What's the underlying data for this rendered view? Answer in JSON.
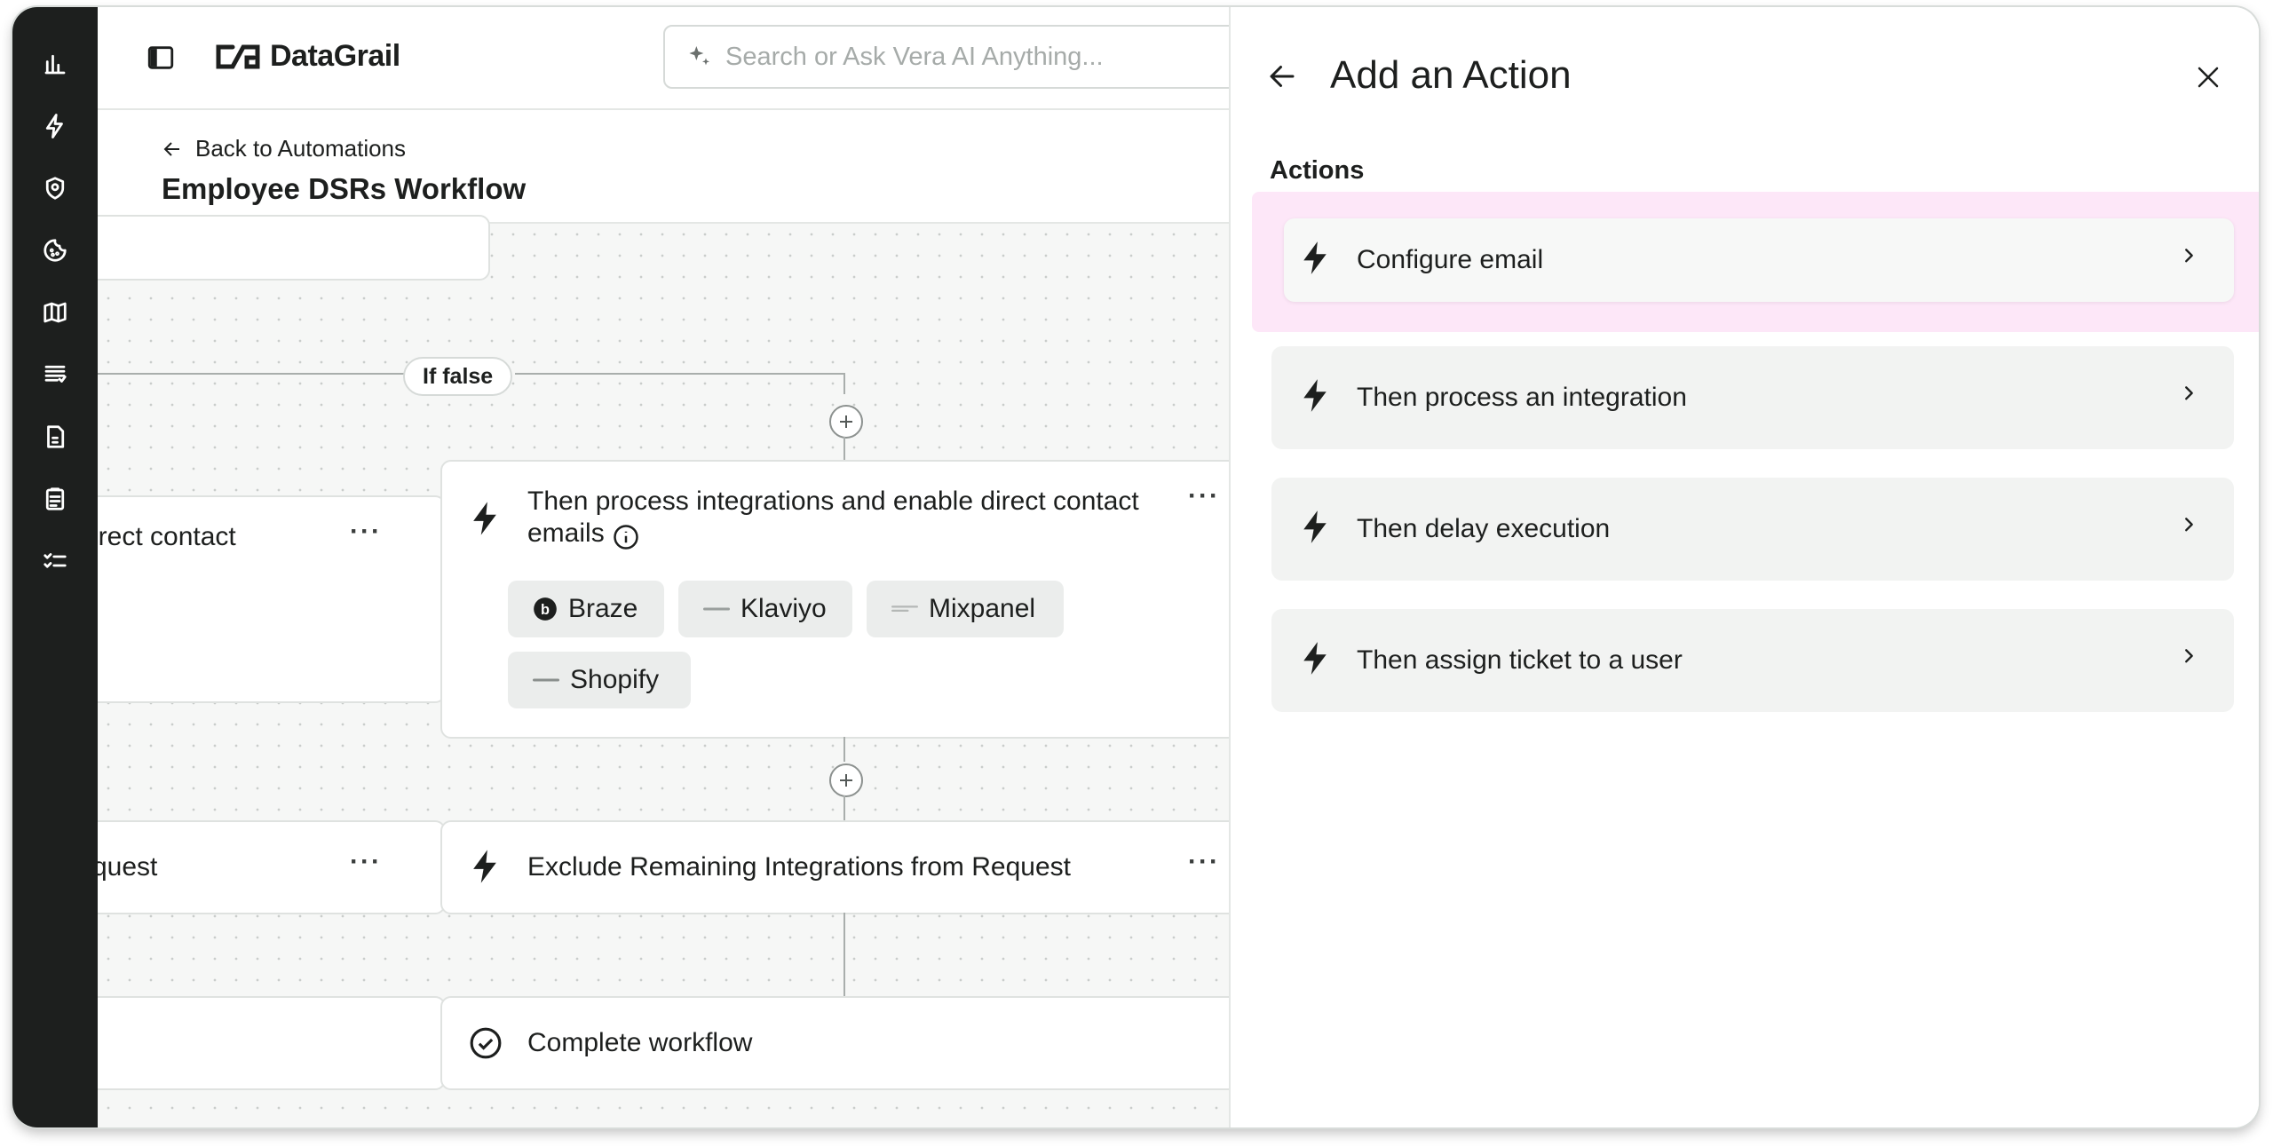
{
  "app": {
    "brand": "DataGrail",
    "search_placeholder": "Search or Ask Vera AI Anything..."
  },
  "rail": {
    "icons": [
      "dashboard-icon",
      "automations-icon",
      "privacy-shield-icon",
      "cookie-icon",
      "map-icon",
      "requests-list-icon",
      "documents-icon",
      "clipboard-icon",
      "tasks-checklist-icon"
    ]
  },
  "header": {
    "back_label": "Back to Automations",
    "title": "Employee DSRs Workflow"
  },
  "canvas": {
    "branch_label": "If false",
    "left_nodes": {
      "contact_fragment": "irect contact",
      "request_fragment": "quest"
    },
    "main_node": {
      "title_line1": "Then process integrations and enable direct contact",
      "title_line2": "emails",
      "integrations": [
        "Braze",
        "Klaviyo",
        "Mixpanel",
        "Shopify"
      ]
    },
    "exclude_node": {
      "title": "Exclude Remaining Integrations from Request"
    },
    "complete_node": {
      "title": "Complete workflow"
    }
  },
  "panel": {
    "title": "Add an Action",
    "section_label": "Actions",
    "actions": [
      {
        "label": "Configure email"
      },
      {
        "label": "Then process an integration"
      },
      {
        "label": "Then delay execution"
      },
      {
        "label": "Then assign ticket to a user"
      }
    ],
    "highlight_color": "#fde7f8"
  }
}
